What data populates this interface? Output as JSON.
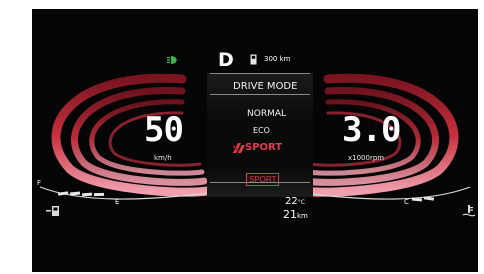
{
  "gear": "D",
  "range": "300 km",
  "speed": {
    "value": "50",
    "unit": "km/h"
  },
  "rpm": {
    "value": "3.0",
    "unit": "x1000rpm"
  },
  "drive_mode": {
    "title": "DRIVE MODE",
    "options": [
      "NORMAL",
      "ECO",
      "SPORT"
    ],
    "selected": "SPORT",
    "badge": "SPORT"
  },
  "temperature": {
    "value": "22",
    "unit": "°C"
  },
  "trip": {
    "value": "21",
    "unit": "km"
  },
  "fuel_gauge": {
    "full_label": "F",
    "empty_label": "E"
  },
  "temp_gauge": {
    "cold_label": "C"
  },
  "colors": {
    "accent_red": "#e23a4a",
    "gauge_red": "#c8303d",
    "indicator_green": "#3bb34a"
  },
  "icons": [
    "headlight-indicator-icon",
    "fuel-pump-icon",
    "fuel-level-icon",
    "coolant-temp-icon",
    "drive-mode-icon"
  ]
}
